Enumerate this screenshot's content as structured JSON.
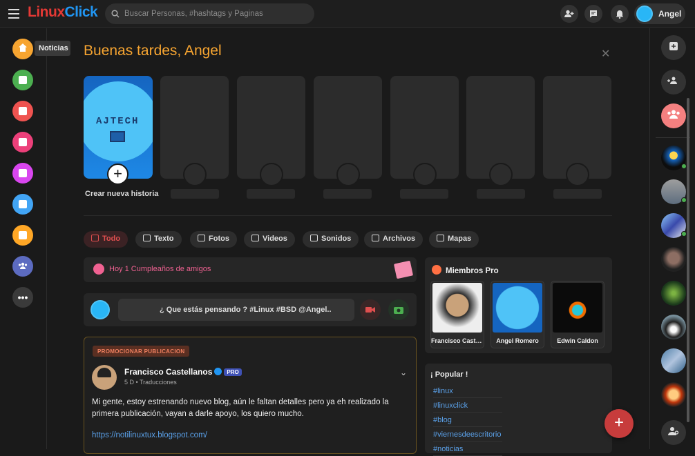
{
  "header": {
    "logo_part1": "Linux",
    "logo_part2": "Click",
    "search_placeholder": "Buscar Personas, #hashtags y Paginas",
    "user_name": "Angel"
  },
  "sidebar": {
    "tooltip": "Noticias",
    "items": [
      {
        "icon": "home-icon",
        "color": "#f7a531"
      },
      {
        "icon": "albums-icon",
        "color": "#4caf50"
      },
      {
        "icon": "bookmark-icon",
        "color": "#ef5350"
      },
      {
        "icon": "calendar-icon",
        "color": "#ec407a"
      },
      {
        "icon": "megaphone-icon",
        "color": "#d946ef"
      },
      {
        "icon": "blog-icon",
        "color": "#42a5f5"
      },
      {
        "icon": "flag-icon",
        "color": "#ffa726"
      },
      {
        "icon": "groups-icon",
        "color": "#5c6bc0"
      },
      {
        "icon": "more-icon",
        "color": "#3a3a3a"
      }
    ]
  },
  "greeting": "Buenas tardes, Angel",
  "stories": {
    "create_label": "Crear nueva historia",
    "create_image_text": "AJTECH"
  },
  "filters": [
    "Todo",
    "Texto",
    "Fotos",
    "Videos",
    "Sonidos",
    "Archivos",
    "Mapas"
  ],
  "birthday": {
    "text": "Hoy 1 Cumpleaños de amigos"
  },
  "composer": {
    "placeholder": "¿ Que estás pensando ? #Linux #BSD @Angel.."
  },
  "post": {
    "promo_label": "PROMOCIONAR PUBLICACION",
    "author": "Francisco Castellanos",
    "badge": "PRO",
    "time": "5 D",
    "category": "Traducciones",
    "text": "Mi gente, estoy estrenando nuevo blog, aún le faltan detalles pero ya eh realizado la primera publicación, vayan a darle apoyo, los quiero mucho.",
    "link": "https://notilinuxtux.blogspot.com/"
  },
  "pro_members": {
    "title": "Miembros Pro",
    "members": [
      {
        "name": "Francisco Castellanos"
      },
      {
        "name": "Angel Romero"
      },
      {
        "name": "Edwin Caldon"
      }
    ]
  },
  "popular": {
    "title": "¡ Popular !",
    "tags": [
      "#linux",
      "#linuxclick",
      "#blog",
      "#viernesdeescritorio",
      "#noticias"
    ]
  },
  "colors": {
    "accent": "#f7a531",
    "brand_red": "#e53935",
    "brand_blue": "#2196f3",
    "link": "#5aa0e8",
    "danger": "#e04f4f"
  }
}
